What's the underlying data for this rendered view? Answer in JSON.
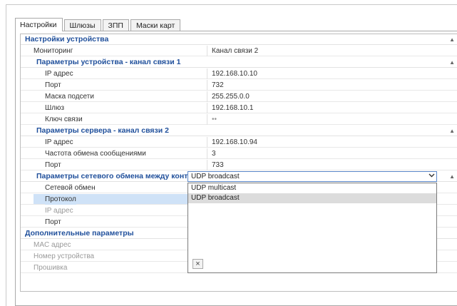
{
  "tabs": [
    {
      "label": "Настройки"
    },
    {
      "label": "Шлюзы"
    },
    {
      "label": "ЗПП"
    },
    {
      "label": "Маски карт"
    }
  ],
  "sections": {
    "device": {
      "title": "Настройки устройства"
    },
    "monitoring": {
      "label": "Мониторинг",
      "value": "Канал связи 2"
    },
    "device_params": {
      "title": "Параметры устройства - канал связи 1"
    },
    "ip": {
      "label": "IP адрес",
      "value": "192.168.10.10"
    },
    "port": {
      "label": "Порт",
      "value": "732"
    },
    "mask": {
      "label": "Маска подсети",
      "value": "255.255.0.0"
    },
    "gateway": {
      "label": "Шлюз",
      "value": "192.168.10.1"
    },
    "key": {
      "label": "Ключ связи",
      "value": "••"
    },
    "server_params": {
      "title": "Параметры сервера - канал связи 2"
    },
    "server_ip": {
      "label": "IP адрес",
      "value": "192.168.10.94"
    },
    "freq": {
      "label": "Частота обмена сообщениями",
      "value": "3"
    },
    "server_port": {
      "label": "Порт",
      "value": "733"
    },
    "net_exchange": {
      "title": "Параметры сетевого обмена между контроллерами"
    },
    "net_flag": {
      "label": "Сетевой обмен",
      "checked": true
    },
    "protocol": {
      "label": "Протокол",
      "value": "UDP broadcast"
    },
    "net_ip": {
      "label": "IP адрес"
    },
    "net_port": {
      "label": "Порт"
    },
    "extra": {
      "title": "Дополнительные параметры"
    },
    "mac": {
      "label": "MAC адрес"
    },
    "dev_num": {
      "label": "Номер устройства"
    },
    "firmware": {
      "label": "Прошивка"
    }
  },
  "dropdown": {
    "options": [
      "UDP multicast",
      "UDP broadcast"
    ],
    "highlighted": "UDP broadcast",
    "close_glyph": "×"
  }
}
